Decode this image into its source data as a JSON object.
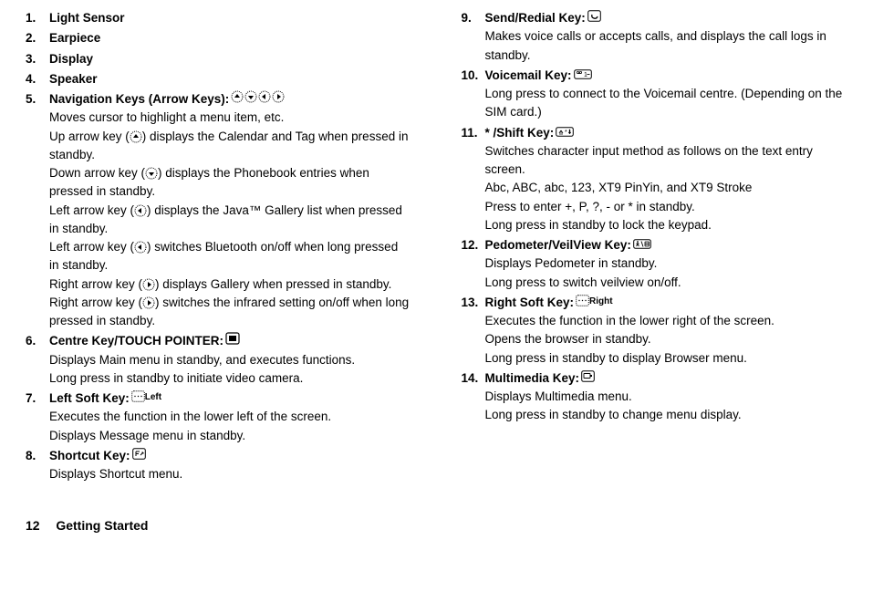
{
  "left": {
    "i1": {
      "num": "1.",
      "title": "Light Sensor"
    },
    "i2": {
      "num": "2.",
      "title": "Earpiece"
    },
    "i3": {
      "num": "3.",
      "title": "Display"
    },
    "i4": {
      "num": "4.",
      "title": "Speaker"
    },
    "i5": {
      "num": "5.",
      "title": "Navigation Keys (Arrow Keys): ",
      "d1": "Moves cursor to highlight a menu item, etc.",
      "d2a": "Up arrow key (",
      "d2b": ") displays the Calendar and Tag when pressed in standby.",
      "d3a": "Down arrow key (",
      "d3b": ") displays the Phonebook entries when pressed in standby.",
      "d4a": "Left arrow key (",
      "d4b": ") displays the Java™ Gallery list when pressed in standby.",
      "d5a": "Left arrow key (",
      "d5b": ") switches Bluetooth on/off when long pressed in standby.",
      "d6a": "Right arrow key (",
      "d6b": ") displays Gallery when pressed in standby.",
      "d7a": "Right arrow key (",
      "d7b": ") switches the infrared setting on/off when long pressed in standby."
    },
    "i6": {
      "num": "6.",
      "title": "Centre Key/TOUCH POINTER: ",
      "d1": "Displays Main menu in standby, and executes functions.",
      "d2": "Long press in standby to initiate video camera."
    },
    "i7": {
      "num": "7.",
      "title": "Left Soft Key: ",
      "d1": "Executes the function in the lower left of the screen.",
      "d2": "Displays Message menu in standby."
    },
    "i8": {
      "num": "8.",
      "title": "Shortcut Key: ",
      "d1": "Displays Shortcut menu."
    }
  },
  "right": {
    "i9": {
      "num": "9.",
      "title": "Send/Redial Key: ",
      "d1": "Makes voice calls or accepts calls, and displays the call logs in standby."
    },
    "i10": {
      "num": "10.",
      "title": "Voicemail Key: ",
      "d1": "Long press to connect to the Voicemail centre. (Depending on the SIM card.)"
    },
    "i11": {
      "num": "11.",
      "title": "* /Shift Key: ",
      "d1": "Switches character input method as follows on the text entry screen.",
      "d2": "Abc, ABC, abc, 123, XT9 PinYin, and XT9 Stroke",
      "d3": "Press to enter +, P, ?, - or * in standby.",
      "d4": "Long press in standby to lock the keypad."
    },
    "i12": {
      "num": "12.",
      "title": "Pedometer/VeilView Key: ",
      "d1": "Displays Pedometer in standby.",
      "d2": "Long press to switch veilview on/off."
    },
    "i13": {
      "num": "13.",
      "title": "Right Soft Key: ",
      "d1": "Executes the function in the lower right of the screen.",
      "d2": "Opens the browser in standby.",
      "d3": "Long press in standby to display Browser menu."
    },
    "i14": {
      "num": "14.",
      "title": "Multimedia Key: ",
      "d1": "Displays Multimedia menu.",
      "d2": "Long press in standby to change menu display."
    }
  },
  "footer": {
    "page_num": "12",
    "section": "Getting Started"
  },
  "softkey_labels": {
    "left": "Left",
    "right": "Right"
  }
}
